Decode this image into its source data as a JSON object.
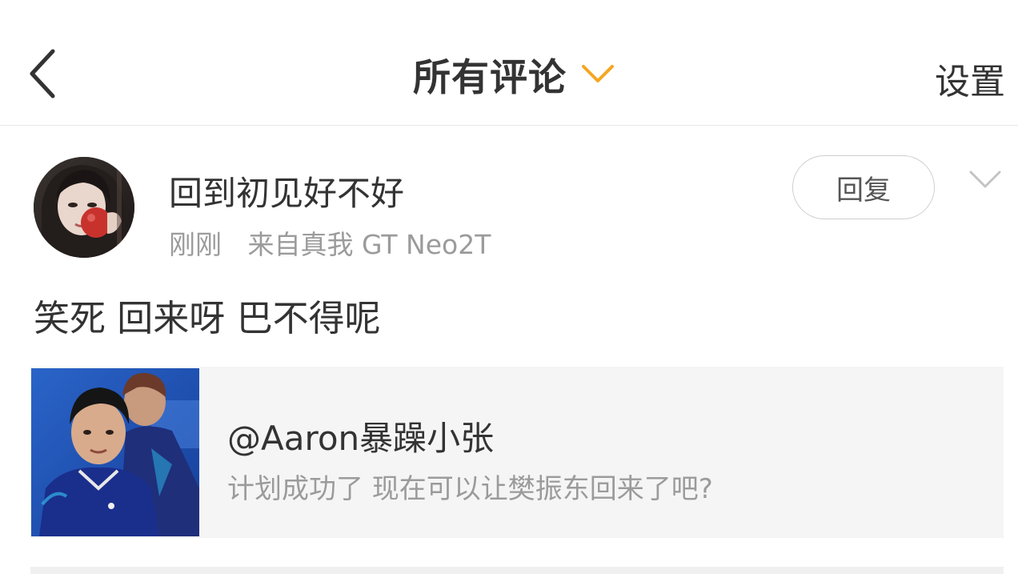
{
  "header": {
    "title": "所有评论",
    "settings_label": "设置"
  },
  "comment": {
    "username": "回到初见好不好",
    "time": "刚刚",
    "source": "来自真我 GT Neo2T",
    "reply_label": "回复",
    "text": "笑死 回来呀 巴不得呢"
  },
  "quote": {
    "author": "@Aaron暴躁小张",
    "text": "计划成功了 现在可以让樊振东回来了吧?"
  },
  "colors": {
    "accent": "#f5a623",
    "text_primary": "#333333",
    "text_secondary": "#9b9b9b",
    "card_background": "#f5f5f5"
  },
  "icons": {
    "back": "chevron-left-icon",
    "title_dropdown": "chevron-down-icon",
    "comment_more": "chevron-down-icon"
  }
}
